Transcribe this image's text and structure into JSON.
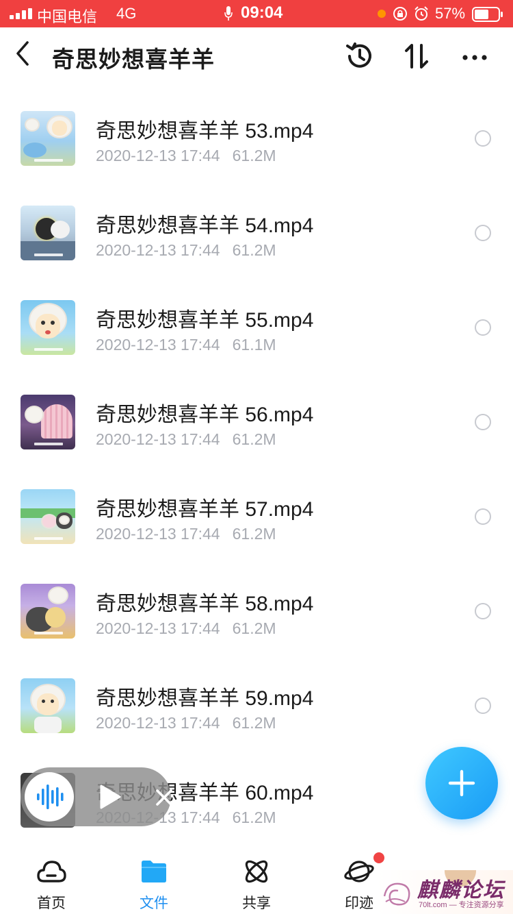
{
  "status_bar": {
    "carrier": "中国电信",
    "network": "4G",
    "time": "09:04",
    "battery": "57%"
  },
  "header": {
    "title": "奇思妙想喜羊羊"
  },
  "files": [
    {
      "name": "奇思妙想喜羊羊 53.mp4",
      "date": "2020-12-13 17:44",
      "size": "61.2M"
    },
    {
      "name": "奇思妙想喜羊羊 54.mp4",
      "date": "2020-12-13 17:44",
      "size": "61.2M"
    },
    {
      "name": "奇思妙想喜羊羊 55.mp4",
      "date": "2020-12-13 17:44",
      "size": "61.1M"
    },
    {
      "name": "奇思妙想喜羊羊 56.mp4",
      "date": "2020-12-13 17:44",
      "size": "61.2M"
    },
    {
      "name": "奇思妙想喜羊羊 57.mp4",
      "date": "2020-12-13 17:44",
      "size": "61.2M"
    },
    {
      "name": "奇思妙想喜羊羊 58.mp4",
      "date": "2020-12-13 17:44",
      "size": "61.2M"
    },
    {
      "name": "奇思妙想喜羊羊 59.mp4",
      "date": "2020-12-13 17:44",
      "size": "61.2M"
    },
    {
      "name": "奇思妙想喜羊羊 60.mp4",
      "date": "2020-12-13 17:44",
      "size": "61.2M"
    }
  ],
  "nav": {
    "home": "首页",
    "files": "文件",
    "share": "共享",
    "trace": "印迹"
  },
  "watermark": {
    "text": "麒麟论坛",
    "sub": "70lt.com — 专注资源分享"
  },
  "colors": {
    "status_bar": "#f04040",
    "accent": "#1e8ff0",
    "fab": "#1a9cf6",
    "meta_text": "#a7aab1",
    "badge": "#f04444"
  },
  "icons": {
    "back": "chevron-left-icon",
    "history": "history-icon",
    "sort": "sort-icon",
    "more": "more-icon",
    "add": "plus-icon",
    "home": "cloud-icon",
    "files": "folder-icon",
    "share": "atom-icon",
    "trace": "planet-icon"
  }
}
